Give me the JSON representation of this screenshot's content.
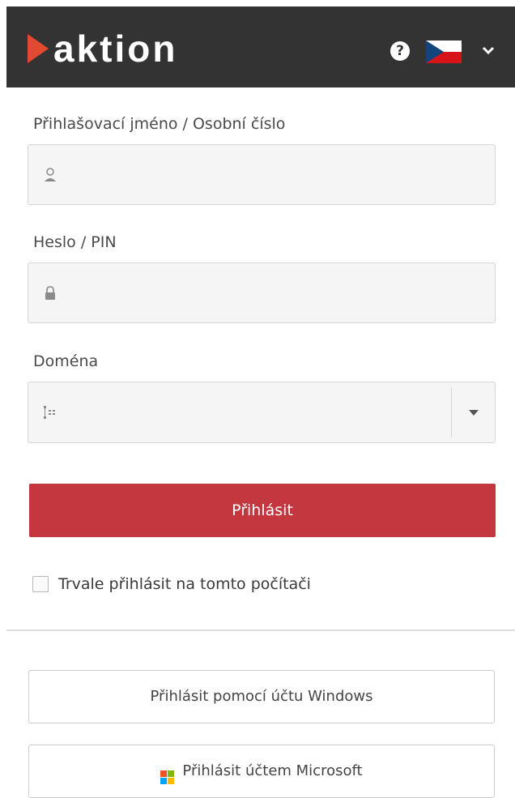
{
  "header": {
    "logo_text": "aktion",
    "help_symbol": "?",
    "language_flag": "flag-cz-icon",
    "colors": {
      "bar": "#333333",
      "logo_accent": "#e04a2f"
    }
  },
  "form": {
    "username": {
      "label": "Přihlašovací jméno / Osobní číslo",
      "value": "",
      "icon": "user-icon"
    },
    "password": {
      "label": "Heslo / PIN",
      "value": "",
      "icon": "lock-icon"
    },
    "domain": {
      "label": "Doména",
      "value": "",
      "icon": "domain-tree-icon"
    },
    "login_label": "Přihlásit",
    "remember_label": "Trvale přihlásit na tomto počítači",
    "remember_checked": false,
    "colors": {
      "primary": "#c5373f"
    }
  },
  "alt_logins": {
    "windows_label": "Přihlásit pomocí účtu Windows",
    "microsoft_label": "Přihlásit účtem Microsoft"
  }
}
